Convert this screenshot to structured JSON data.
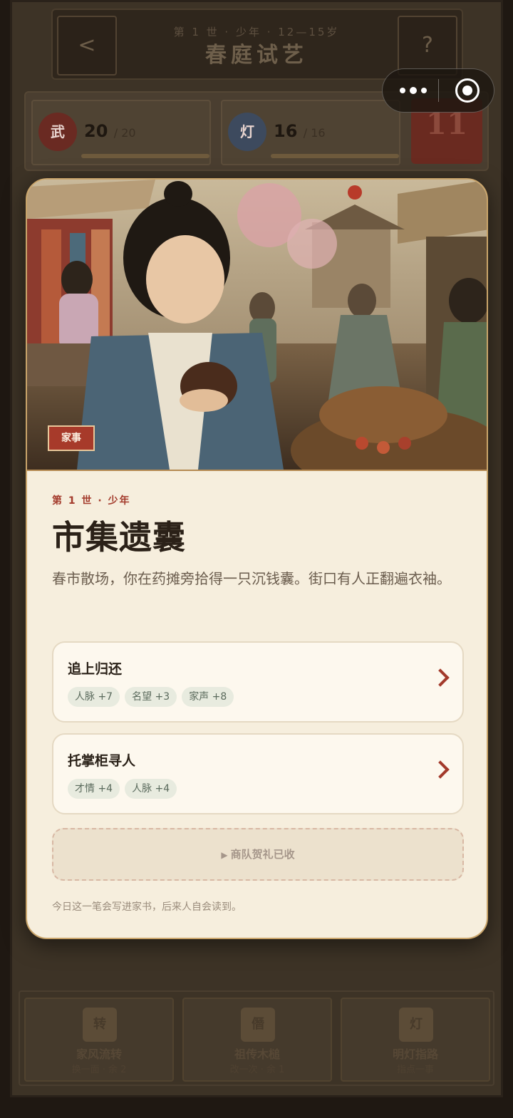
{
  "header": {
    "stage_label": "第 1 世 · 少年 · 12—15岁",
    "title": "春庭试艺",
    "back_glyph": "<",
    "help_glyph": "?"
  },
  "stats": [
    {
      "icon": "武",
      "value": "20",
      "max": "/ 20",
      "bar_fill": 1.0
    },
    {
      "icon": "灯",
      "value": "16",
      "max": "/ 16",
      "bar_fill": 1.0
    }
  ],
  "turn_counter": "11",
  "bottom_actions": [
    {
      "seal": "转",
      "name": "家风流转",
      "sub": "换一面 · 余 2"
    },
    {
      "seal": "僭",
      "name": "祖传木槌",
      "sub": "改一次 · 余 1"
    },
    {
      "seal": "灯",
      "name": "明灯指路",
      "sub": "指点一事"
    }
  ],
  "event": {
    "tag": "家事",
    "kicker": "第 1 世 · 少年",
    "title": "市集遗囊",
    "description": "春市散场，你在药摊旁拾得一只沉钱囊。街口有人正翻遍衣袖。",
    "choices": [
      {
        "label": "追上归还",
        "effects": [
          "人脉 +7",
          "名望 +3",
          "家声 +8"
        ]
      },
      {
        "label": "托掌柜寻人",
        "effects": [
          "才情 +4",
          "人脉 +4"
        ]
      }
    ],
    "gift_button": "商队贺礼已收",
    "gift_play_glyph": "▶",
    "footer_note": "今日这一笔会写进家书，后来人自会读到。"
  },
  "colors": {
    "accent_red": "#a33a2b",
    "card_bg": "#f6eedd",
    "card_border": "#c9a46a",
    "chip_bg": "#e8ebdf"
  }
}
